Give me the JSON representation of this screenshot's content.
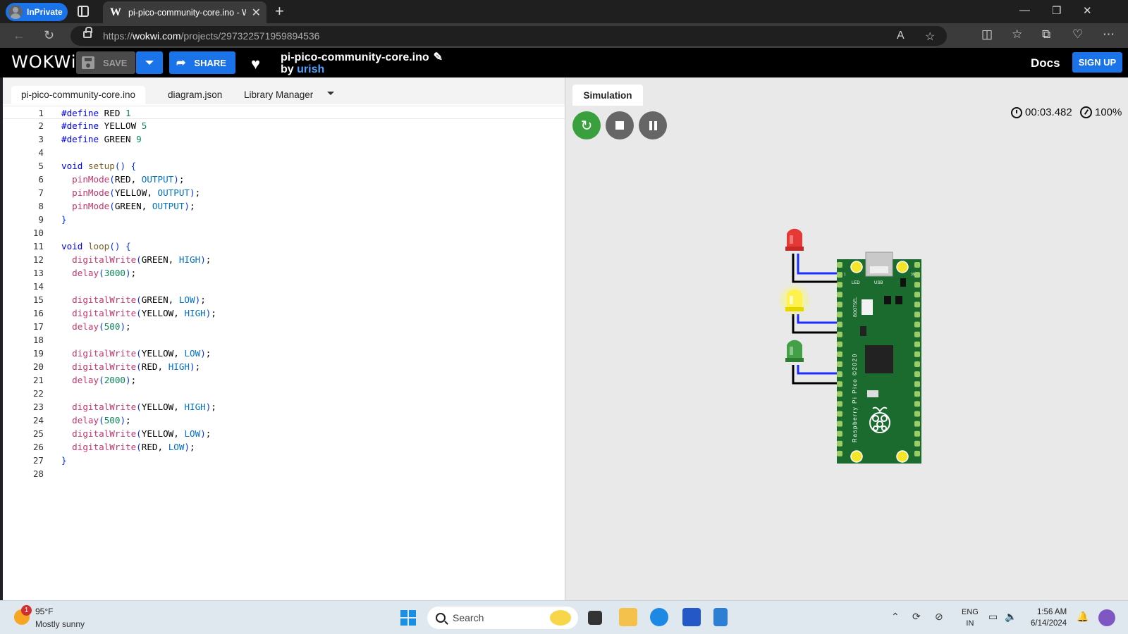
{
  "browser": {
    "inprivate_label": "InPrivate",
    "tab_title": "pi-pico-community-core.ino - W",
    "url_prefix": "https://",
    "url_host": "wokwi.com",
    "url_path": "/projects/297322571959894536"
  },
  "wokwi": {
    "logo": "WOKWi",
    "save_label": "SAVE",
    "share_label": "SHARE",
    "project_title": "pi-pico-community-core.ino",
    "by_label": "by",
    "author": "urish",
    "docs_label": "Docs",
    "signup_label": "SIGN UP"
  },
  "editor": {
    "tabs": [
      "pi-pico-community-core.ino",
      "diagram.json",
      "Library Manager"
    ],
    "line_numbers": [
      "1",
      "2",
      "3",
      "4",
      "5",
      "6",
      "7",
      "8",
      "9",
      "10",
      "11",
      "12",
      "13",
      "14",
      "15",
      "16",
      "17",
      "18",
      "19",
      "20",
      "21",
      "22",
      "23",
      "24",
      "25",
      "26",
      "27",
      "28"
    ],
    "lines": [
      "#define RED 1",
      "#define YELLOW 5",
      "#define GREEN 9",
      "",
      "void setup() {",
      "  pinMode(RED, OUTPUT);",
      "  pinMode(YELLOW, OUTPUT);",
      "  pinMode(GREEN, OUTPUT);",
      "}",
      "",
      "void loop() {",
      "  digitalWrite(GREEN, HIGH);",
      "  delay(3000);",
      "",
      "  digitalWrite(GREEN, LOW);",
      "  digitalWrite(YELLOW, HIGH);",
      "  delay(500);",
      "",
      "  digitalWrite(YELLOW, LOW);",
      "  digitalWrite(RED, HIGH);",
      "  delay(2000);",
      "",
      "  digitalWrite(YELLOW, HIGH);",
      "  delay(500);",
      "  digitalWrite(YELLOW, LOW);",
      "  digitalWrite(RED, LOW);",
      "}",
      ""
    ]
  },
  "simulation": {
    "tab_label": "Simulation",
    "timer": "00:03.482",
    "speed": "100%",
    "leds": [
      {
        "color": "red",
        "lit": false
      },
      {
        "color": "yellow",
        "lit": true
      },
      {
        "color": "green",
        "lit": false
      }
    ],
    "board_labels": {
      "led": "LED",
      "usb": "USB",
      "bootsel": "BOOTSEL",
      "silkscreen": "Raspberry Pi Pico ©2020",
      "pin1": "1",
      "pin39": "39"
    }
  },
  "taskbar": {
    "weather_badge": "1",
    "temperature": "95°F",
    "condition": "Mostly sunny",
    "search_placeholder": "Search",
    "lang_top": "ENG",
    "lang_bottom": "IN",
    "time": "1:56 AM",
    "date": "6/14/2024"
  },
  "colors": {
    "accent": "#1a73e8",
    "sim_green": "#3aa03e",
    "board_green": "#1b6b2f"
  }
}
